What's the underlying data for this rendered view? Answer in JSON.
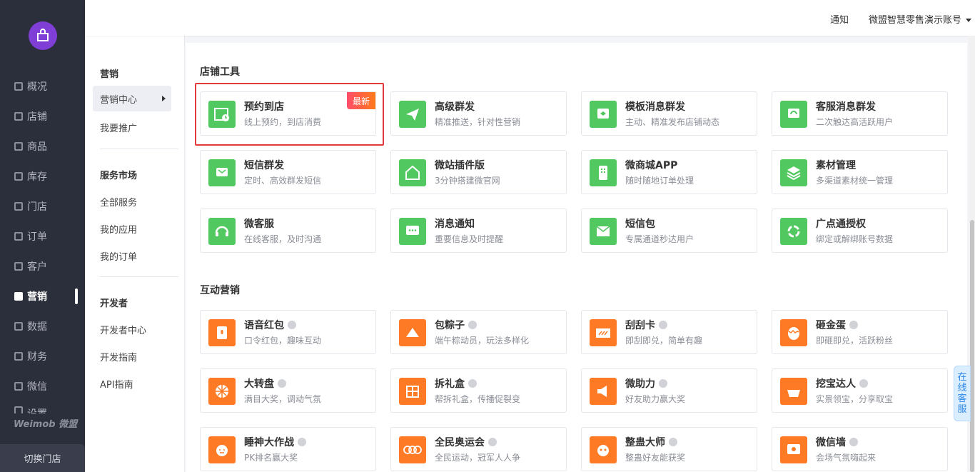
{
  "leftnav": {
    "items": [
      {
        "label": "概况"
      },
      {
        "label": "店铺"
      },
      {
        "label": "商品"
      },
      {
        "label": "库存"
      },
      {
        "label": "门店"
      },
      {
        "label": "订单"
      },
      {
        "label": "客户"
      },
      {
        "label": "营销"
      },
      {
        "label": "数据"
      },
      {
        "label": "财务"
      },
      {
        "label": "微信"
      },
      {
        "label": "设置"
      }
    ],
    "active": "营销",
    "brand": "Weimob 微盟",
    "switch_store": "切换门店"
  },
  "subnav": {
    "g1": {
      "header": "营销",
      "items": [
        "营销中心",
        "我要推广"
      ]
    },
    "g2": {
      "header": "服务市场",
      "items": [
        "全部服务",
        "我的应用",
        "我的订单"
      ]
    },
    "g3": {
      "header": "开发者",
      "items": [
        "开发者中心",
        "开发指南",
        "API指南"
      ]
    }
  },
  "header": {
    "notify": "通知",
    "account": "微盟智慧零售演示账号"
  },
  "sections": {
    "store_tools": {
      "title": "店铺工具",
      "cards": [
        {
          "title": "预约到店",
          "desc": "线上预约，到店消费",
          "badge": "最新"
        },
        {
          "title": "高级群发",
          "desc": "精准推送，针对性营销"
        },
        {
          "title": "模板消息群发",
          "desc": "主动、精准发布店铺动态"
        },
        {
          "title": "客服消息群发",
          "desc": "二次触达高活跃用户"
        },
        {
          "title": "短信群发",
          "desc": "定时、高效群发短信"
        },
        {
          "title": "微站插件版",
          "desc": "3分钟搭建微官网"
        },
        {
          "title": "微商城APP",
          "desc": "随时随地订单处理"
        },
        {
          "title": "素材管理",
          "desc": "多渠道素材统一管理"
        },
        {
          "title": "微客服",
          "desc": "在线客服，及时沟通"
        },
        {
          "title": "消息通知",
          "desc": "重要信息及时提醒"
        },
        {
          "title": "短信包",
          "desc": "专属通道秒达用户"
        },
        {
          "title": "广点通授权",
          "desc": "绑定或解绑账号数据"
        }
      ]
    },
    "interactive": {
      "title": "互动营销",
      "cards": [
        {
          "title": "语音红包",
          "desc": "口令红包，趣味互动"
        },
        {
          "title": "包粽子",
          "desc": "端午粽动员，玩法多样化"
        },
        {
          "title": "刮刮卡",
          "desc": "即刮即兑，简单有趣"
        },
        {
          "title": "砸金蛋",
          "desc": "即砸即兑，活跃粉丝"
        },
        {
          "title": "大转盘",
          "desc": "满目大奖，调动气氛"
        },
        {
          "title": "拆礼盒",
          "desc": "帮拆礼盒，传播促裂变"
        },
        {
          "title": "微助力",
          "desc": "好友助力赢大奖"
        },
        {
          "title": "挖宝达人",
          "desc": "实景领宝，分享取宝"
        },
        {
          "title": "睡神大作战",
          "desc": "PK排名赢大奖"
        },
        {
          "title": "全民奥运会",
          "desc": "全民运动，冠军人人争"
        },
        {
          "title": "整蛊大师",
          "desc": "整蛊好友能获奖"
        },
        {
          "title": "微信墙",
          "desc": "会场气氛嗨起来"
        }
      ]
    }
  },
  "online_service": "在线客服",
  "colors": {
    "green": "#52c861",
    "orange": "#ff7a24",
    "nav_bg": "#2b2e3b",
    "highlight": "#e33b3b"
  }
}
